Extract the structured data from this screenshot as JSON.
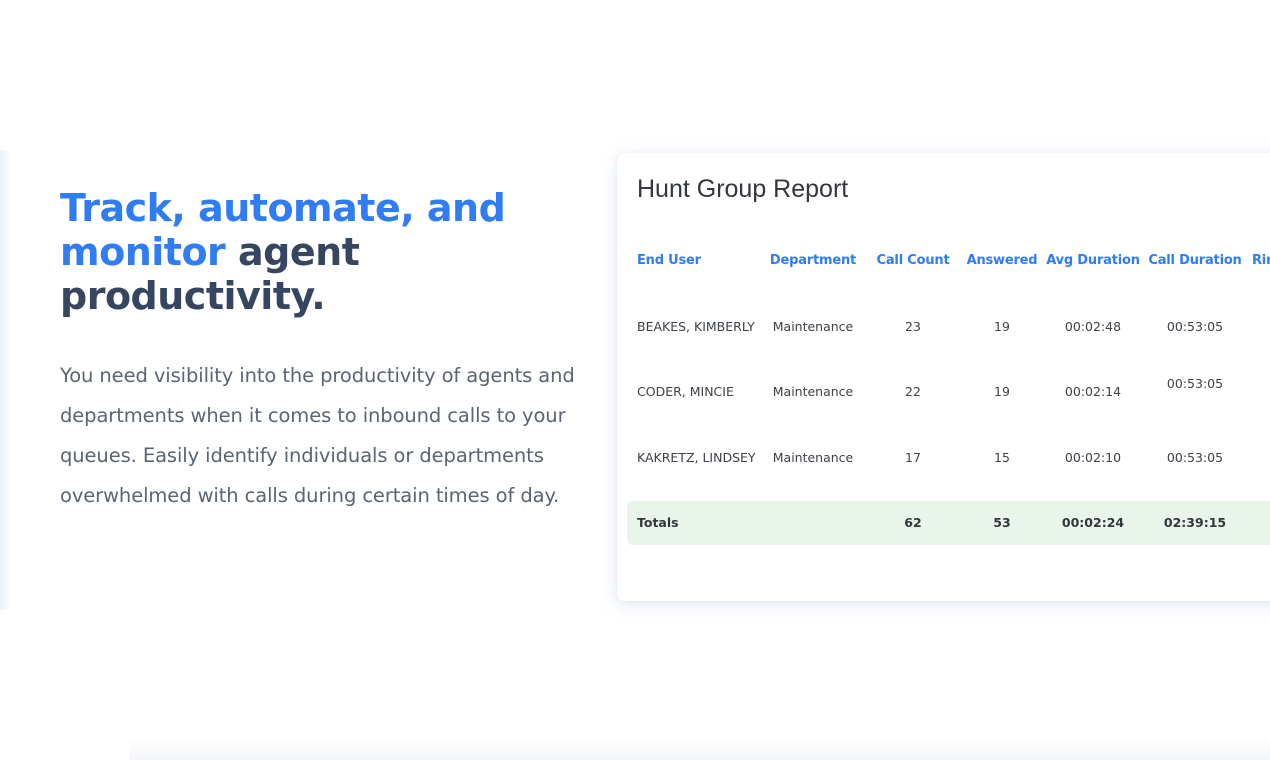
{
  "hero": {
    "headline_accent": "Track, automate, and monitor",
    "headline_rest": " agent productivity.",
    "body": "You need visibility into the productivity of agents and departments when it comes to inbound calls to your queues. Easily identify individuals or departments overwhelmed with calls during certain times of day."
  },
  "report": {
    "title": "Hunt Group Report",
    "columns": [
      "End User",
      "Department",
      "Call Count",
      "Answered",
      "Avg Duration",
      "Call Duration",
      "Rin"
    ],
    "rows": [
      {
        "end_user": "BEAKES, KIMBERLY",
        "department": "Maintenance",
        "call_count": "23",
        "answered": "19",
        "avg_duration": "00:02:48",
        "call_duration": "00:53:05"
      },
      {
        "end_user": "CODER, MINCIE",
        "department": "Maintenance",
        "call_count": "22",
        "answered": "19",
        "avg_duration": "00:02:14",
        "call_duration": "00:53:05"
      },
      {
        "end_user": "KAKRETZ, LINDSEY",
        "department": "Maintenance",
        "call_count": "17",
        "answered": "15",
        "avg_duration": "00:02:10",
        "call_duration": "00:53:05"
      }
    ],
    "totals": {
      "label": "Totals",
      "call_count": "62",
      "answered": "53",
      "avg_duration": "00:02:24",
      "call_duration": "02:39:15"
    }
  },
  "colors": {
    "accent": "#2f7cf3",
    "heading_dark": "#364660",
    "totals_bg": "#e9f5ea"
  }
}
